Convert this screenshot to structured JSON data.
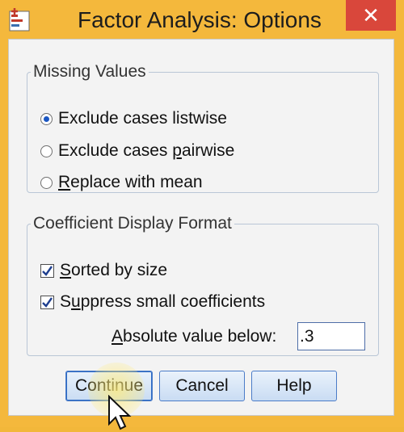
{
  "window": {
    "title": "Factor Analysis: Options",
    "close_glyph": "✕",
    "frame_color": "#f4b83c",
    "close_color": "#d9473b"
  },
  "missing_values": {
    "legend": "Missing Values",
    "options": [
      {
        "label_pre": "Exclude cases listwise",
        "selected": true
      },
      {
        "label_pre": "Exclude cases ",
        "label_u": "p",
        "label_post": "airwise",
        "selected": false
      },
      {
        "label_u": "R",
        "label_post": "eplace with mean",
        "selected": false
      }
    ]
  },
  "coefficient_format": {
    "legend": "Coefficient Display Format",
    "sorted": {
      "label_u": "S",
      "label_post": "orted by size",
      "checked": true
    },
    "suppress": {
      "label_pre": "S",
      "label_u": "u",
      "label_post": "ppress small coefficients",
      "checked": true
    },
    "absolute": {
      "label_u": "A",
      "label_post": "bsolute value below:",
      "value": ".3"
    }
  },
  "buttons": {
    "continue": "Continue",
    "cancel": "Cancel",
    "help": "Help"
  },
  "icons": {
    "app": "spss-factor-icon",
    "close": "close-icon",
    "cursor": "mouse-pointer-icon"
  }
}
